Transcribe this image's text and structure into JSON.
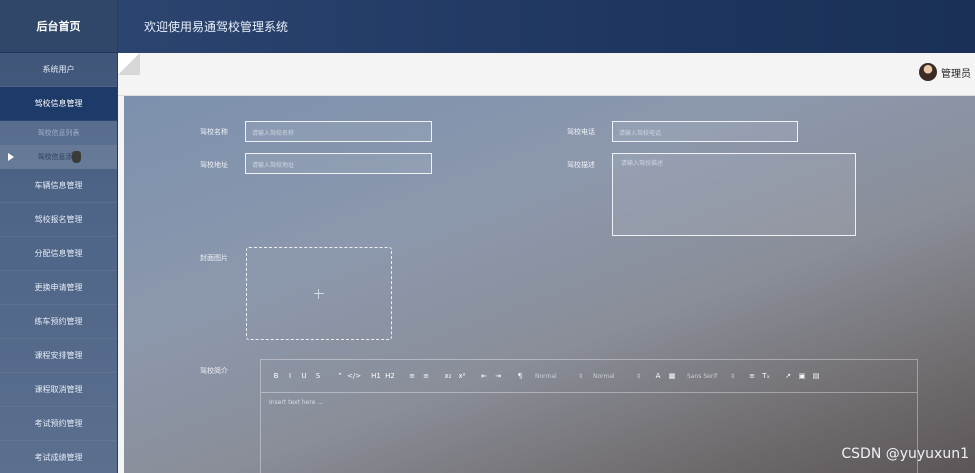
{
  "sidebar": {
    "brand": "后台首页",
    "items": [
      {
        "label": "系统用户"
      },
      {
        "label": "驾校信息管理"
      }
    ],
    "subitems": [
      {
        "label": "驾校信息列表"
      },
      {
        "label": "驾校信息添加"
      }
    ],
    "items2": [
      {
        "label": "车辆信息管理"
      },
      {
        "label": "驾校报名管理"
      },
      {
        "label": "分配信息管理"
      },
      {
        "label": "更换申请管理"
      },
      {
        "label": "练车预约管理"
      },
      {
        "label": "课程安排管理"
      },
      {
        "label": "课程取消管理"
      },
      {
        "label": "考试预约管理"
      },
      {
        "label": "考试成绩管理"
      }
    ]
  },
  "header": {
    "title": "欢迎使用易通驾校管理系统"
  },
  "topbar": {
    "user": "管理员"
  },
  "form": {
    "name_label": "驾校名称",
    "name_placeholder": "请输入驾校名称",
    "phone_label": "驾校电话",
    "phone_placeholder": "请输入驾校电话",
    "address_label": "驾校地址",
    "address_placeholder": "请输入驾校地址",
    "desc_label": "驾校描述",
    "desc_placeholder": "请输入驾校描述",
    "cover_label": "封面图片",
    "intro_label": "驾校简介"
  },
  "editor": {
    "toolbar": [
      "B",
      "I",
      "U",
      "S",
      "”",
      "</>",
      "H1",
      "H2",
      "≡",
      "≡",
      "x₂",
      "x²",
      "⇤",
      "⇥",
      "¶"
    ],
    "font_size": "Normal",
    "heading": "Normal",
    "font_family": "Sans Serif",
    "tools_tail": [
      "A",
      "▦",
      "≡",
      "Tₓ",
      "↗",
      "▣",
      "▤"
    ],
    "placeholder": "Insert text here ..."
  },
  "watermark": "CSDN @yuyuxun1",
  "colors": {
    "sidebar_active": "#1d3a68",
    "header": "#1e3660"
  }
}
